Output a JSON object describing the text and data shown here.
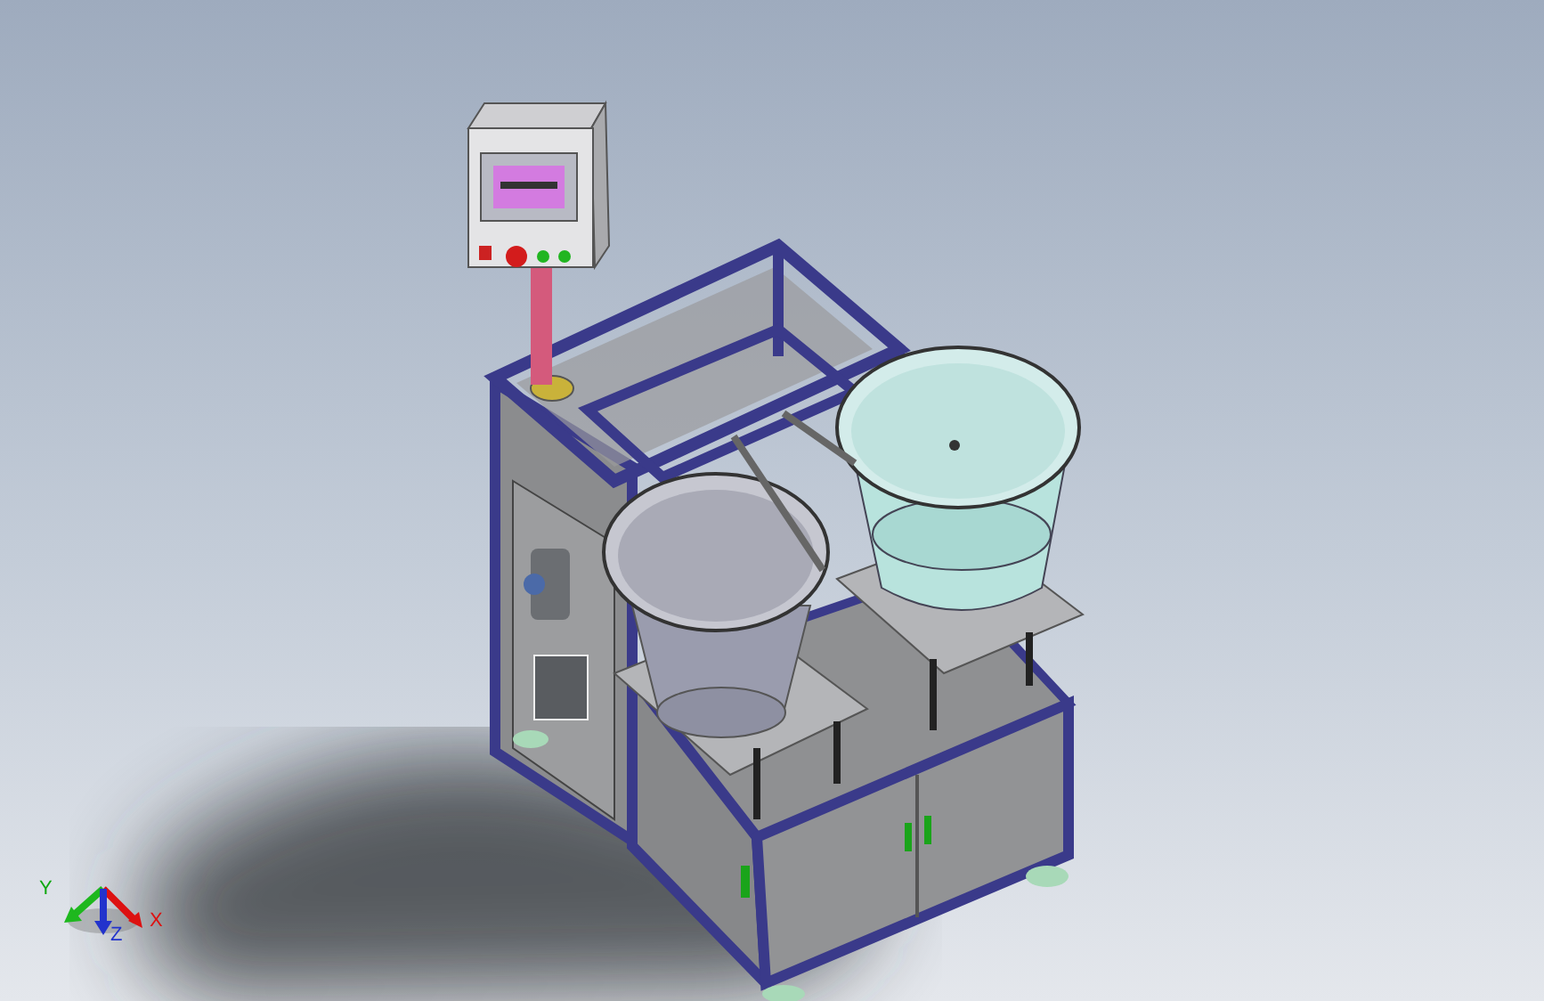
{
  "axis_triad": {
    "x_label": "X",
    "y_label": "Y",
    "z_label": "Z"
  }
}
